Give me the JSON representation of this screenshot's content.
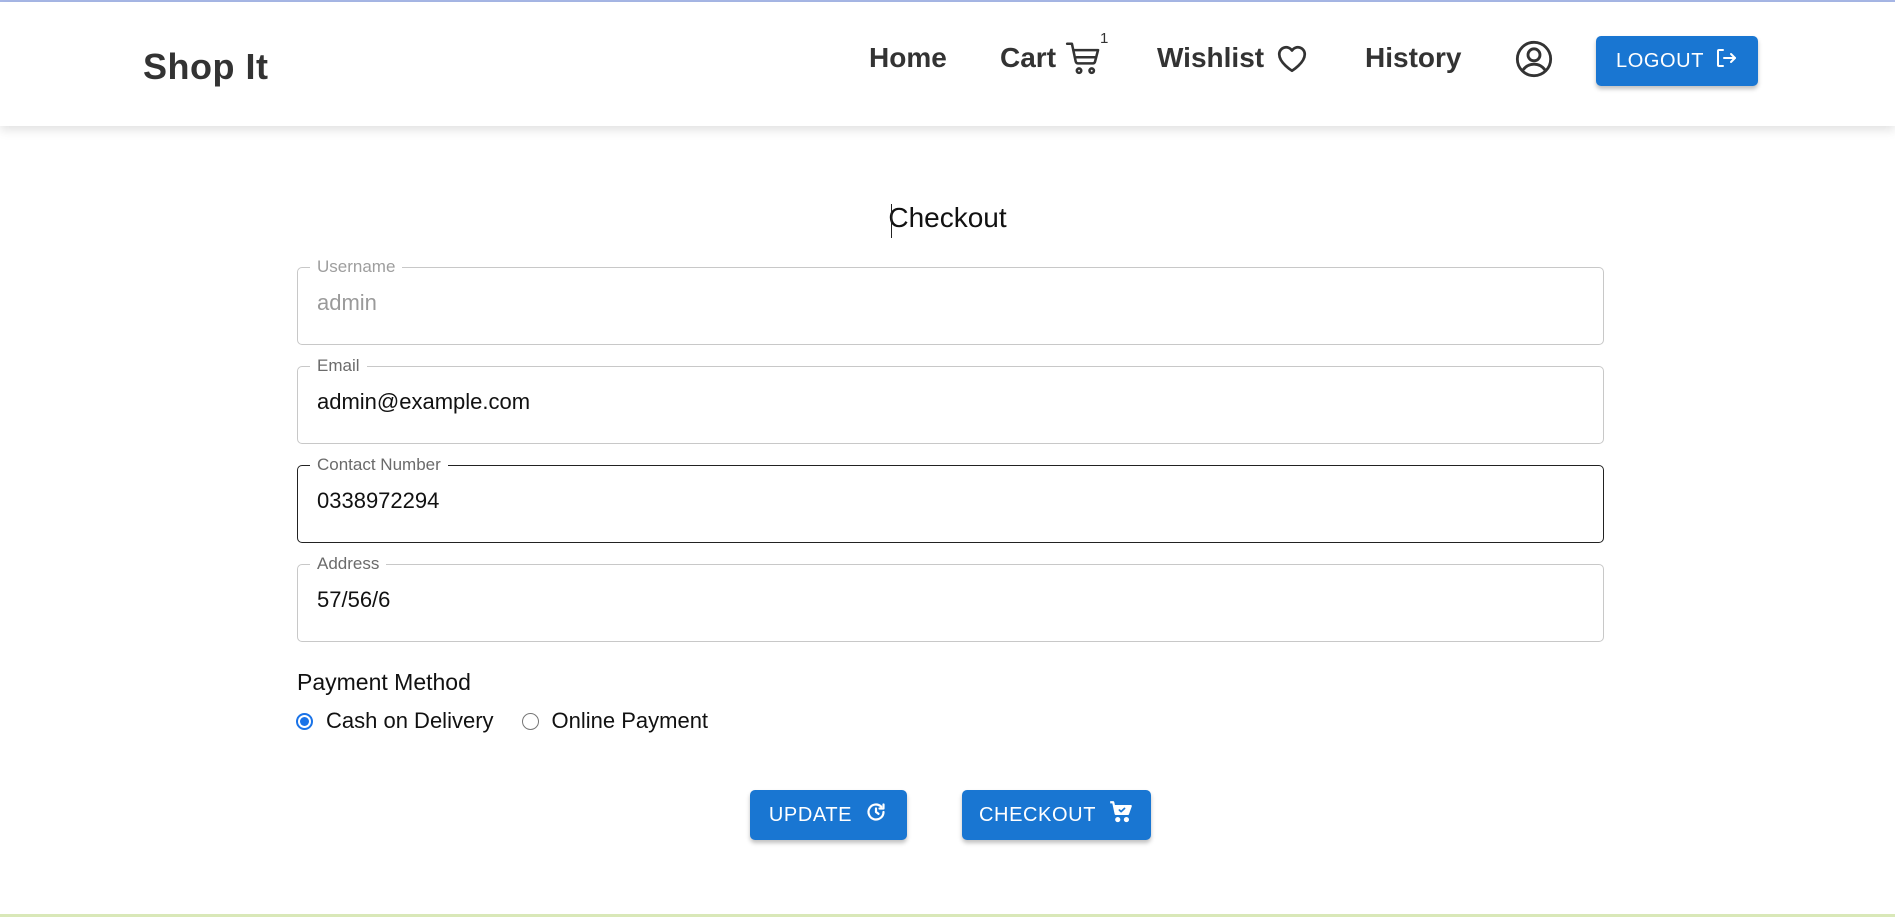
{
  "header": {
    "brand": "Shop It",
    "nav": {
      "home": "Home",
      "cart": "Cart",
      "cart_count": "1",
      "wishlist": "Wishlist",
      "history": "History"
    },
    "logout_label": "LOGOUT"
  },
  "checkout": {
    "title": "Checkout",
    "fields": {
      "username": {
        "label": "Username",
        "value": "admin",
        "disabled": true
      },
      "email": {
        "label": "Email",
        "value": "admin@example.com"
      },
      "contact": {
        "label": "Contact Number",
        "value": "0338972294",
        "focused": true
      },
      "address": {
        "label": "Address",
        "value": "57/56/6"
      }
    },
    "payment": {
      "label": "Payment Method",
      "options": [
        {
          "label": "Cash on Delivery",
          "selected": true
        },
        {
          "label": "Online Payment",
          "selected": false
        }
      ]
    },
    "update_label": "UPDATE",
    "checkout_label": "CHECKOUT"
  },
  "colors": {
    "primary": "#1976d2",
    "text_dark": "#333333",
    "radio_checked": "#1a73e8"
  },
  "icons": {
    "cart": "shopping-cart-icon",
    "wishlist": "heart-outline-icon",
    "account": "account-circle-icon",
    "logout": "logout-icon",
    "update": "refresh-icon",
    "checkout": "cart-check-icon"
  }
}
